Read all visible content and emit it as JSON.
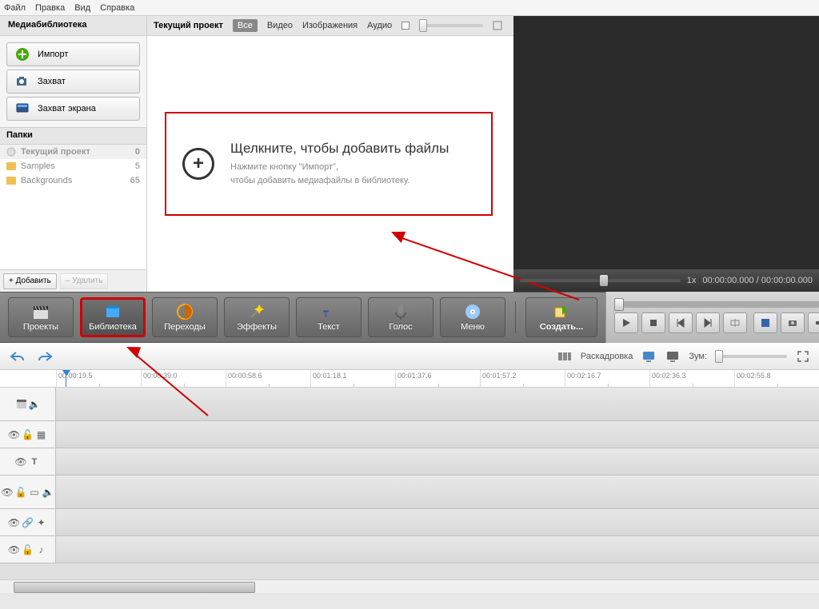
{
  "menu": {
    "file": "Файл",
    "edit": "Правка",
    "view": "Вид",
    "help": "Справка"
  },
  "sidebar": {
    "title": "Медиабиблиотека",
    "import": "Импорт",
    "capture": "Захват",
    "screencap": "Захват экрана",
    "folders_hdr": "Папки",
    "folders": [
      {
        "name": "Текущий проект",
        "count": "0"
      },
      {
        "name": "Samples",
        "count": "5"
      },
      {
        "name": "Backgrounds",
        "count": "65"
      }
    ],
    "add": "+ Добавить",
    "del": "– Удалить"
  },
  "filter": {
    "label": "Текущий проект",
    "all": "Все",
    "video": "Видео",
    "images": "Изображения",
    "audio": "Аудио"
  },
  "drop": {
    "title": "Щелкните, чтобы добавить файлы",
    "sub1": "Нажмите кнопку \"Импорт\",",
    "sub2": "чтобы добавить медиафайлы в библиотеку."
  },
  "preview": {
    "speed": "1x",
    "time": "00:00:00.000 / 00:00:00.000"
  },
  "modes": {
    "projects": "Проекты",
    "library": "Библиотека",
    "transitions": "Переходы",
    "effects": "Эффекты",
    "text": "Текст",
    "voice": "Голос",
    "menu": "Меню",
    "create": "Создать..."
  },
  "tlbar": {
    "storyboard": "Раскадровка",
    "zoom": "Зум:"
  },
  "ruler": [
    "00:00:19.5",
    "00:00:39.0",
    "00:00:58.6",
    "00:01:18.1",
    "00:01:37.6",
    "00:01:57.2",
    "00:02:16.7",
    "00:02:36.3",
    "00:02:55.8"
  ]
}
